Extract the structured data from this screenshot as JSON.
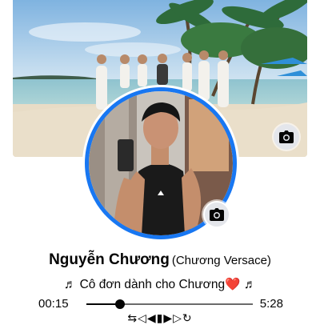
{
  "profile": {
    "name": "Nguyễn Chương",
    "alt_name": "(Chương Versace)",
    "bio_prefix": "♬ Cô đơn dành cho Chương",
    "bio_heart": "❤️",
    "bio_suffix": " ♬"
  },
  "player": {
    "current_time": "00:15",
    "total_time": "5:28",
    "progress": 0.2,
    "controls": "⇆◁◀▮▶▷↻"
  },
  "icons": {
    "cover_camera": "camera-icon",
    "avatar_camera": "camera-icon"
  },
  "colors": {
    "avatar_ring": "#1877f2",
    "camera_button": "#e4e6eb",
    "heart": "#e0245e"
  }
}
